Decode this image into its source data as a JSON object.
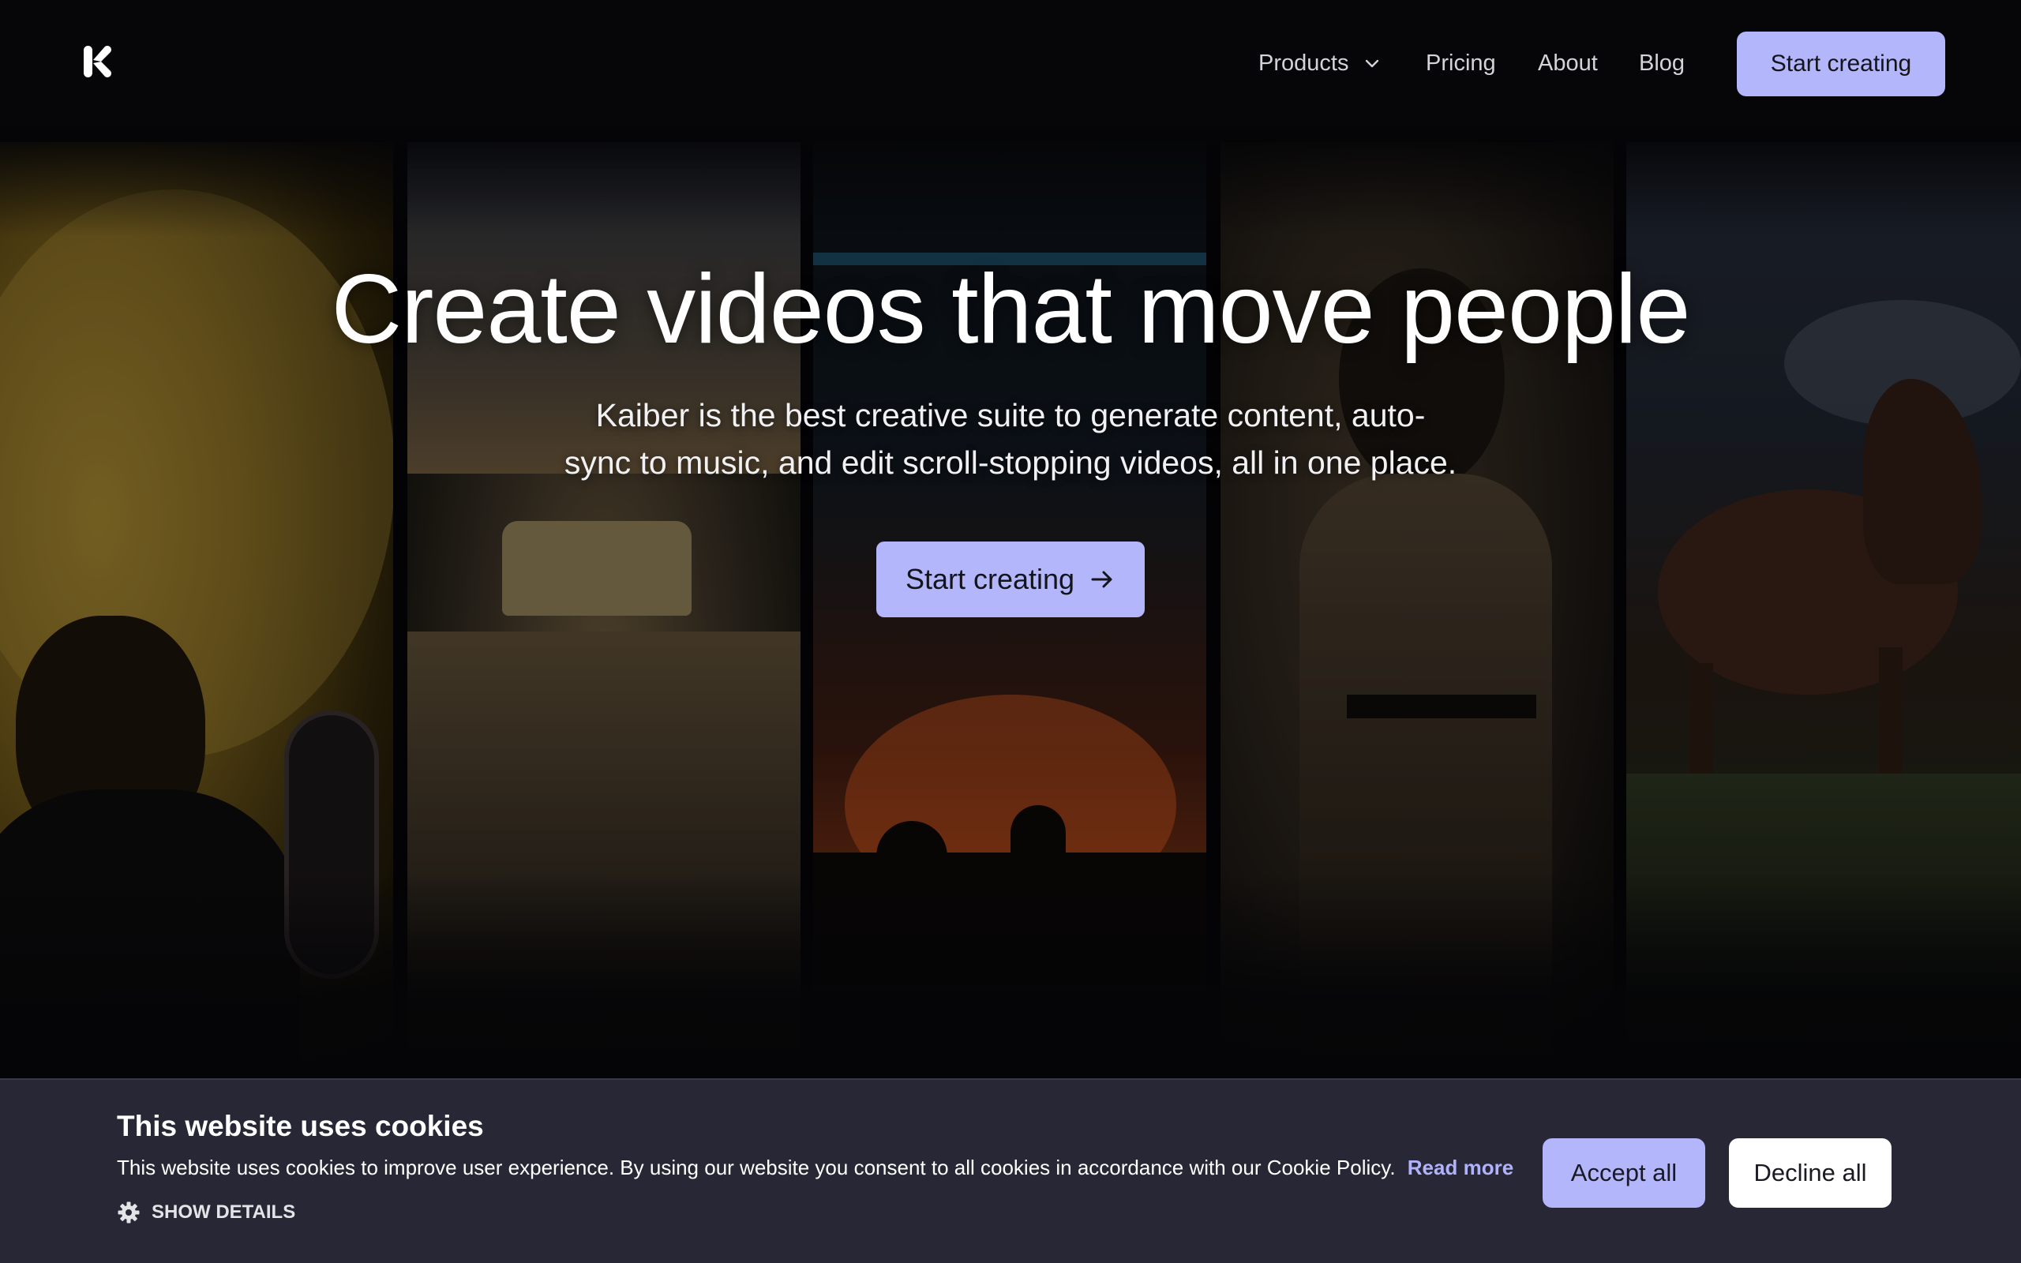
{
  "header": {
    "logo_icon": "kaiber-k-logo",
    "nav": [
      {
        "label": "Products",
        "has_dropdown": true
      },
      {
        "label": "Pricing"
      },
      {
        "label": "About"
      },
      {
        "label": "Blog"
      }
    ],
    "cta_label": "Start creating"
  },
  "hero": {
    "title": "Create videos that move people",
    "subtitle_line1": "Kaiber is the best creative suite to generate content, auto-",
    "subtitle_line2": "sync to music, and edit scroll-stopping videos, all in one place.",
    "cta_label": "Start creating",
    "cta_icon": "arrow-right-icon"
  },
  "cookie_banner": {
    "title": "This website uses cookies",
    "text": "This website uses cookies to improve user experience. By using our website you consent to all cookies in accordance with our Cookie Policy.",
    "read_more": "Read more",
    "show_details": "SHOW DETAILS",
    "accept_label": "Accept all",
    "decline_label": "Decline all"
  },
  "colors": {
    "accent": "#b4b6fc",
    "banner_bg": "#282736",
    "page_bg": "#060608"
  }
}
